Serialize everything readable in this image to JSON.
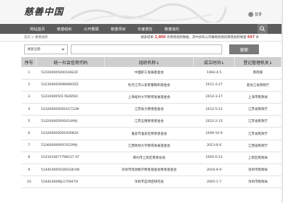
{
  "header": {
    "logo": "慈善中国",
    "user_label": "登录"
  },
  "nav": {
    "items": [
      "网站首页",
      "慈善组织",
      "公开募捐",
      "慈善项目",
      "年度报告",
      "慈善信托"
    ]
  },
  "breadcrumb": {
    "text": "首页 > 慈善组织",
    "stats_prefix": "搜索结果 ",
    "stats_count1": "2,806",
    "stats_middle": " 条慈善组织数据，其中具有公开募捐资格的慈善组织数量 ",
    "stats_count2": "697",
    "stats_suffix": " 条"
  },
  "search": {
    "select_value": "搜索全部",
    "input_value": "",
    "button": "搜索"
  },
  "table": {
    "headers": [
      "序号",
      "统一社会信用代码",
      "组织名称↓",
      "成立时间↓",
      "登记管理机关↓"
    ],
    "rows": [
      {
        "no": "1",
        "code": "53100000500016922F",
        "name": "中国职工发展基金会",
        "date": "1994-4-5",
        "org": "民政部"
      },
      {
        "no": "2",
        "code": "53230000569898935Z",
        "name": "牡丹江市公安民警数和基金会",
        "date": "2011-4-27",
        "org": "黑龙江省民政厅"
      },
      {
        "no": "3",
        "code": "53310000501782856C",
        "name": "上海纽约大学教育发展基金会",
        "date": "2014-3-27",
        "org": "上海市民政局"
      },
      {
        "no": "4",
        "code": "53320000509161712M",
        "name": "江苏省力慈善基金会",
        "date": "2012-5-21",
        "org": "江苏省民政厅"
      },
      {
        "no": "5",
        "code": "53320000509161499J",
        "name": "江苏五粮慈善基金会",
        "date": "2012-2-15",
        "org": "江苏省民政厅"
      },
      {
        "no": "6",
        "code": "53320000509160082X",
        "name": "淮安市淮安区慈善基金会",
        "date": "2009-10-9",
        "org": "江苏省民政厅"
      },
      {
        "no": "7",
        "code": "53360000069742299J",
        "name": "江西财经大学教育发展基金会",
        "date": "2013-6-6",
        "org": "江西省民政厅"
      },
      {
        "no": "8",
        "code": "5141010677798127 47",
        "name": "郑州市上街区慈善总会",
        "date": "2005-6-22",
        "org": "上街区民政局"
      },
      {
        "no": "9",
        "code": "51440300502693361W",
        "name": "深圳市残源助学慈善基金会慈善基金会",
        "date": "2016-9-9",
        "org": "深圳市民政局"
      },
      {
        "no": "10",
        "code": "53440300MJL170947H",
        "name": "深圳市自闭症研究会",
        "date": "2005-1-7",
        "org": "深圳市民政局"
      }
    ]
  }
}
